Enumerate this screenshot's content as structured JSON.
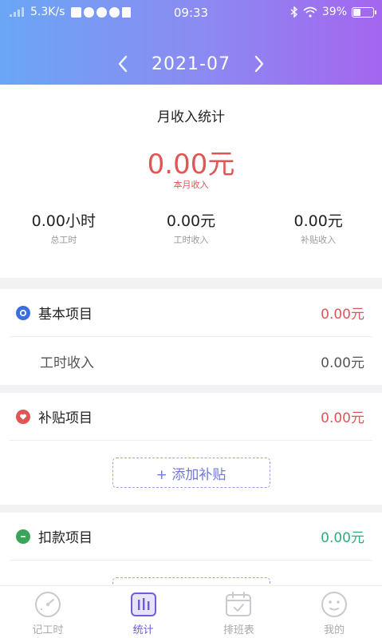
{
  "status_bar": {
    "speed": "5.3K/s",
    "time": "09:33",
    "battery": "39%",
    "battery_level": 0.39
  },
  "header": {
    "month": "2021-07",
    "prev_icon": "chevron-left-icon",
    "next_icon": "chevron-right-icon"
  },
  "summary": {
    "title": "月收入统计",
    "month_income_value": "0.00元",
    "month_income_label": "本月收入",
    "stats": [
      {
        "value": "0.00小时",
        "label": "总工时"
      },
      {
        "value": "0.00元",
        "label": "工时收入"
      },
      {
        "value": "0.00元",
        "label": "补贴收入"
      }
    ]
  },
  "basic": {
    "title": "基本项目",
    "amount": "0.00元",
    "rows": [
      {
        "label": "工时收入",
        "value": "0.00元"
      }
    ]
  },
  "subsidy": {
    "title": "补贴项目",
    "amount": "0.00元",
    "add_label": "+ 添加补贴"
  },
  "deduction": {
    "title": "扣款项目",
    "amount": "0.00元"
  },
  "tabs": [
    {
      "label": "记工时",
      "icon": "clock-gauge-icon",
      "active": false
    },
    {
      "label": "统计",
      "icon": "stats-icon",
      "active": true
    },
    {
      "label": "排班表",
      "icon": "calendar-icon",
      "active": false
    },
    {
      "label": "我的",
      "icon": "face-icon",
      "active": false
    }
  ],
  "colors": {
    "red": "#e05556",
    "green": "#2ab07c",
    "blue": "#3b6fe0",
    "accent": "#6c5fd6"
  }
}
